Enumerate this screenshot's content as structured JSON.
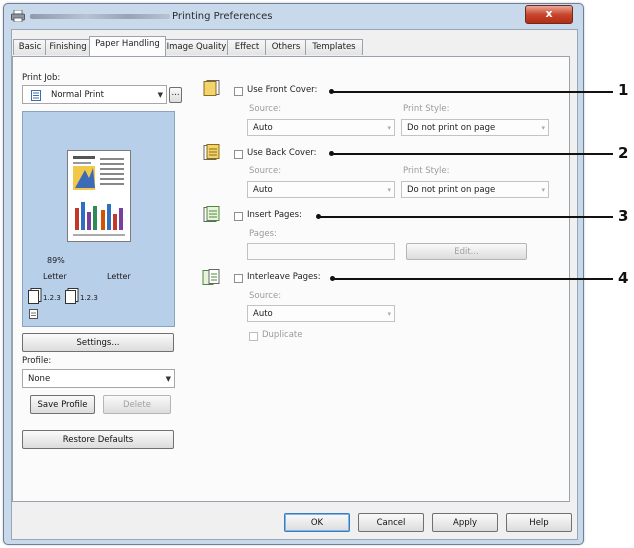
{
  "window": {
    "title": "Printing Preferences",
    "close_label": "x"
  },
  "tabs": [
    "Basic",
    "Finishing",
    "Paper Handling",
    "Image Quality",
    "Effect",
    "Others",
    "Templates"
  ],
  "active_tab": "Paper Handling",
  "left": {
    "print_job_label": "Print Job:",
    "print_job_value": "Normal Print",
    "more_button": "...",
    "preview_zoom": "89%",
    "preview_paper_left": "Letter",
    "preview_paper_right": "Letter",
    "tray_label_1": "1.2.3",
    "tray_label_2": "1.2.3",
    "settings_button": "Settings...",
    "profile_label": "Profile:",
    "profile_value": "None",
    "save_profile_button": "Save Profile",
    "delete_button": "Delete",
    "restore_defaults_button": "Restore Defaults"
  },
  "front_cover": {
    "label": "Use Front Cover:",
    "source_label": "Source:",
    "source_value": "Auto",
    "print_style_label": "Print Style:",
    "print_style_value": "Do not print on page",
    "callout": "1"
  },
  "back_cover": {
    "label": "Use Back Cover:",
    "source_label": "Source:",
    "source_value": "Auto",
    "print_style_label": "Print Style:",
    "print_style_value": "Do not print on page",
    "callout": "2"
  },
  "insert_pages": {
    "label": "Insert Pages:",
    "pages_label": "Pages:",
    "pages_value": "",
    "edit_button": "Edit...",
    "callout": "3"
  },
  "interleave_pages": {
    "label": "Interleave Pages:",
    "source_label": "Source:",
    "source_value": "Auto",
    "duplicate_label": "Duplicate",
    "callout": "4"
  },
  "footer": {
    "ok": "OK",
    "cancel": "Cancel",
    "apply": "Apply",
    "help": "Help"
  }
}
